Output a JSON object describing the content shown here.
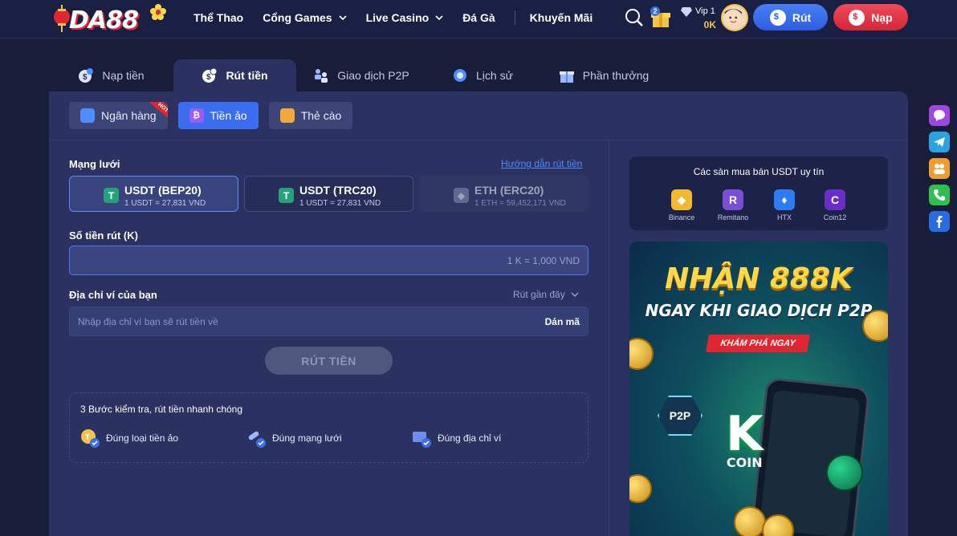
{
  "header": {
    "logo_text": "DA88",
    "nav": [
      {
        "label": "Thể Thao",
        "has_dropdown": false
      },
      {
        "label": "Cổng Games",
        "has_dropdown": true
      },
      {
        "label": "Live Casino",
        "has_dropdown": true
      },
      {
        "label": "Đá Gà",
        "has_dropdown": false
      },
      {
        "label": "Khuyến Mãi",
        "has_dropdown": false
      }
    ],
    "gift_count": "2",
    "vip_label": "Vip 1",
    "balance": "0K",
    "withdraw_label": "Rút",
    "deposit_label": "Nạp"
  },
  "tabs": [
    {
      "label": "Nạp tiền",
      "icon": "deposit-icon",
      "active": false
    },
    {
      "label": "Rút tiền",
      "icon": "withdraw-icon",
      "active": true
    },
    {
      "label": "Giao dịch P2P",
      "icon": "p2p-icon",
      "active": false
    },
    {
      "label": "Lịch sử",
      "icon": "history-icon",
      "active": false
    },
    {
      "label": "Phần thưởng",
      "icon": "gift-icon",
      "active": false
    }
  ],
  "subtabs": [
    {
      "label": "Ngân hàng",
      "icon": "bank-icon",
      "badge": "HOT",
      "active": false
    },
    {
      "label": "Tiền ảo",
      "icon": "crypto-icon",
      "active": true
    },
    {
      "label": "Thẻ cào",
      "icon": "card-icon",
      "active": false
    }
  ],
  "form": {
    "network_label": "Mạng lưới",
    "guide_link": "Hướng dẫn rút tiền",
    "networks": [
      {
        "name": "USDT (BEP20)",
        "rate": "1 USDT = 27,831 VND",
        "icon": "tether-icon",
        "state": "active"
      },
      {
        "name": "USDT (TRC20)",
        "rate": "1 USDT = 27,831 VND",
        "icon": "tether-icon",
        "state": "normal"
      },
      {
        "name": "ETH (ERC20)",
        "rate": "1 ETH = 59,452,171 VND",
        "icon": "ethereum-icon",
        "state": "disabled"
      }
    ],
    "amount_label": "Số tiền rút (K)",
    "amount_hint": "1 K = 1,000 VND",
    "address_label": "Địa chỉ ví của bạn",
    "recent_label": "Rút gần đây",
    "address_placeholder": "Nhập địa chỉ ví bạn sẽ rút tiền về",
    "paste_label": "Dán mã",
    "submit_label": "RÚT TIỀN",
    "steps_title": "3 Bước kiểm tra, rút tiền nhanh chóng",
    "steps": [
      {
        "label": "Đúng loại tiền ảo",
        "icon": "coin-check-icon"
      },
      {
        "label": "Đúng mạng lưới",
        "icon": "network-check-icon"
      },
      {
        "label": "Đúng địa chỉ ví",
        "icon": "wallet-check-icon"
      }
    ]
  },
  "exchanges": {
    "title": "Các sàn mua bán USDT uy tín",
    "items": [
      {
        "name": "Binance",
        "color": "#f3ba2f"
      },
      {
        "name": "Remitano",
        "color": "#7a4fd6"
      },
      {
        "name": "HTX",
        "color": "#2d7cf6"
      },
      {
        "name": "Coin12",
        "color": "#6a2ec8"
      }
    ]
  },
  "promo": {
    "headline": "NHẬN 888K",
    "subheadline": "NGAY KHI GIAO DỊCH P2P",
    "cta": "KHÁM PHÁ NGAY",
    "badge": "P2P",
    "brand_letter": "K",
    "brand_word": "COIN"
  },
  "social": [
    "messenger-icon",
    "telegram-icon",
    "group-icon",
    "phone-icon",
    "facebook-icon"
  ]
}
